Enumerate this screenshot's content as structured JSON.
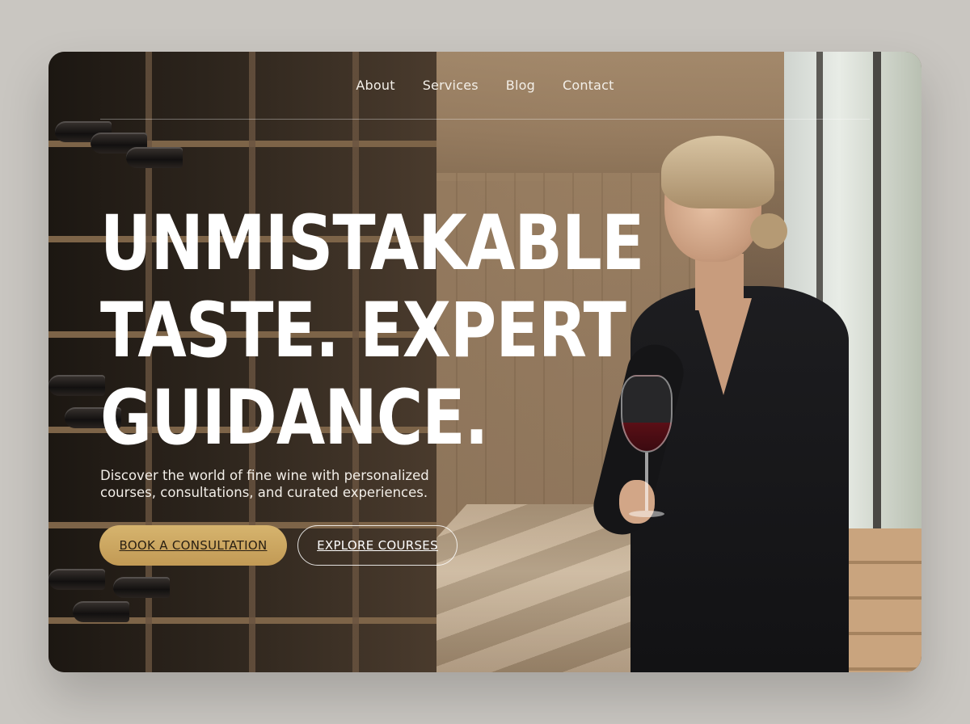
{
  "nav": {
    "items": [
      {
        "label": "About"
      },
      {
        "label": "Services"
      },
      {
        "label": "Blog"
      },
      {
        "label": "Contact"
      }
    ]
  },
  "hero": {
    "headline": [
      "UNMISTAKABLE",
      "TASTE. EXPERT",
      "GUIDANCE."
    ],
    "subtitle": "Discover the world of fine wine with personalized courses, consultations, and curated experiences.",
    "primary_button": "BOOK A CONSULTATION",
    "secondary_button": "EXPLORE COURSES"
  },
  "colors": {
    "page_background": "#c9c6c1",
    "accent_gold": "#c9a460",
    "text_light": "#ffffff"
  }
}
